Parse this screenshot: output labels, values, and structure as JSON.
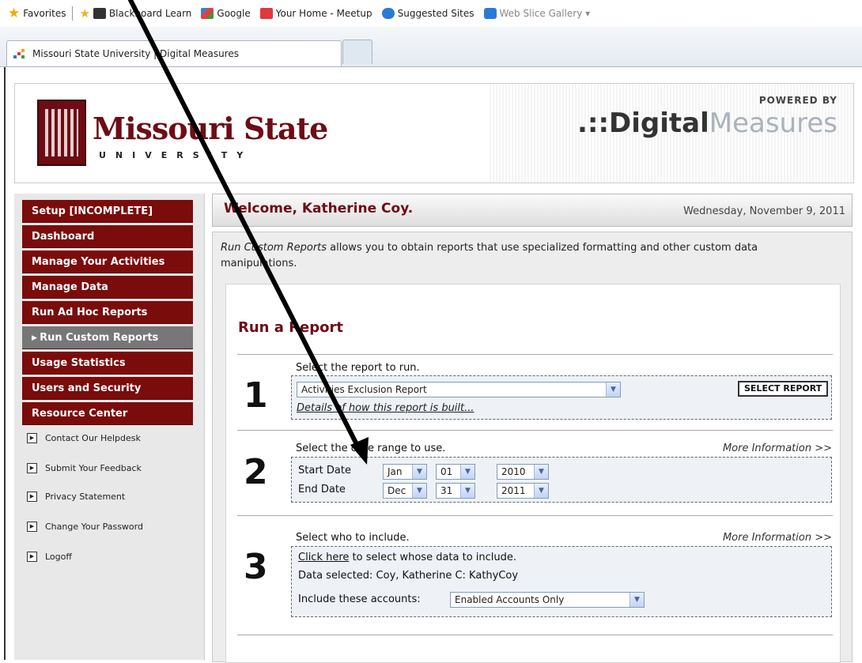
{
  "favorites": {
    "label": "Favorites",
    "items": [
      {
        "label": "Blackboard Learn",
        "icon": "blackboard-icon",
        "color": "#2a2a2a"
      },
      {
        "label": "Google",
        "icon": "google-icon",
        "color": "#3a8e3a"
      },
      {
        "label": "Your Home - Meetup",
        "icon": "meetup-icon",
        "color": "#e0393e"
      },
      {
        "label": "Suggested Sites",
        "icon": "ie-icon",
        "color": "#2a7ad5"
      },
      {
        "label": "Web Slice Gallery ▾",
        "icon": "ie-icon",
        "color": "#2a7ad5"
      }
    ]
  },
  "tab": {
    "title": "Missouri State University | Digital Measures"
  },
  "header": {
    "msu_name": "Missouri State",
    "msu_univ": "UNIVERSITY",
    "powered_by": "POWERED BY",
    "dm_dots": ".::",
    "dm_bold": "Digital",
    "dm_light": "Measures"
  },
  "sidebar": {
    "items": [
      {
        "label": "Setup [INCOMPLETE]",
        "active": false
      },
      {
        "label": "Dashboard",
        "active": false
      },
      {
        "label": "Manage Your Activities",
        "active": false
      },
      {
        "label": "Manage Data",
        "active": false
      },
      {
        "label": "Run Ad Hoc Reports",
        "active": false
      },
      {
        "label": "Run Custom Reports",
        "active": true
      },
      {
        "label": "Usage Statistics",
        "active": false
      },
      {
        "label": "Users and Security",
        "active": false
      },
      {
        "label": "Resource Center",
        "active": false
      }
    ],
    "links": [
      "Contact Our Helpdesk",
      "Submit Your Feedback",
      "Privacy Statement",
      "Change Your Password",
      "Logoff"
    ]
  },
  "welcome": {
    "greeting": "Welcome, Katherine Coy.",
    "date": "Wednesday, November 9, 2011"
  },
  "intro": {
    "emphasis": "Run Custom Reports",
    "rest": " allows you to obtain reports that use specialized formatting and other custom data manipulations."
  },
  "run": {
    "title": "Run a Report",
    "step1": {
      "num": "1",
      "label": "Select the report to run.",
      "report_value": "Activities Exclusion Report",
      "button": "SELECT REPORT",
      "details": "Details of how this report is built..."
    },
    "step2": {
      "num": "2",
      "label": "Select the date range to use.",
      "more": "More Information >>",
      "start_label": "Start Date",
      "start_month": "Jan",
      "start_day": "01",
      "start_year": "2010",
      "end_label": "End Date",
      "end_month": "Dec",
      "end_day": "31",
      "end_year": "2011"
    },
    "step3": {
      "num": "3",
      "label": "Select who to include.",
      "more": "More Information >>",
      "click_here": "Click here",
      "click_rest": " to select whose data to include.",
      "data_selected": "Data selected: Coy, Katherine C: KathyCoy",
      "include_label": "Include these accounts:",
      "include_value": "Enabled Accounts Only"
    }
  }
}
